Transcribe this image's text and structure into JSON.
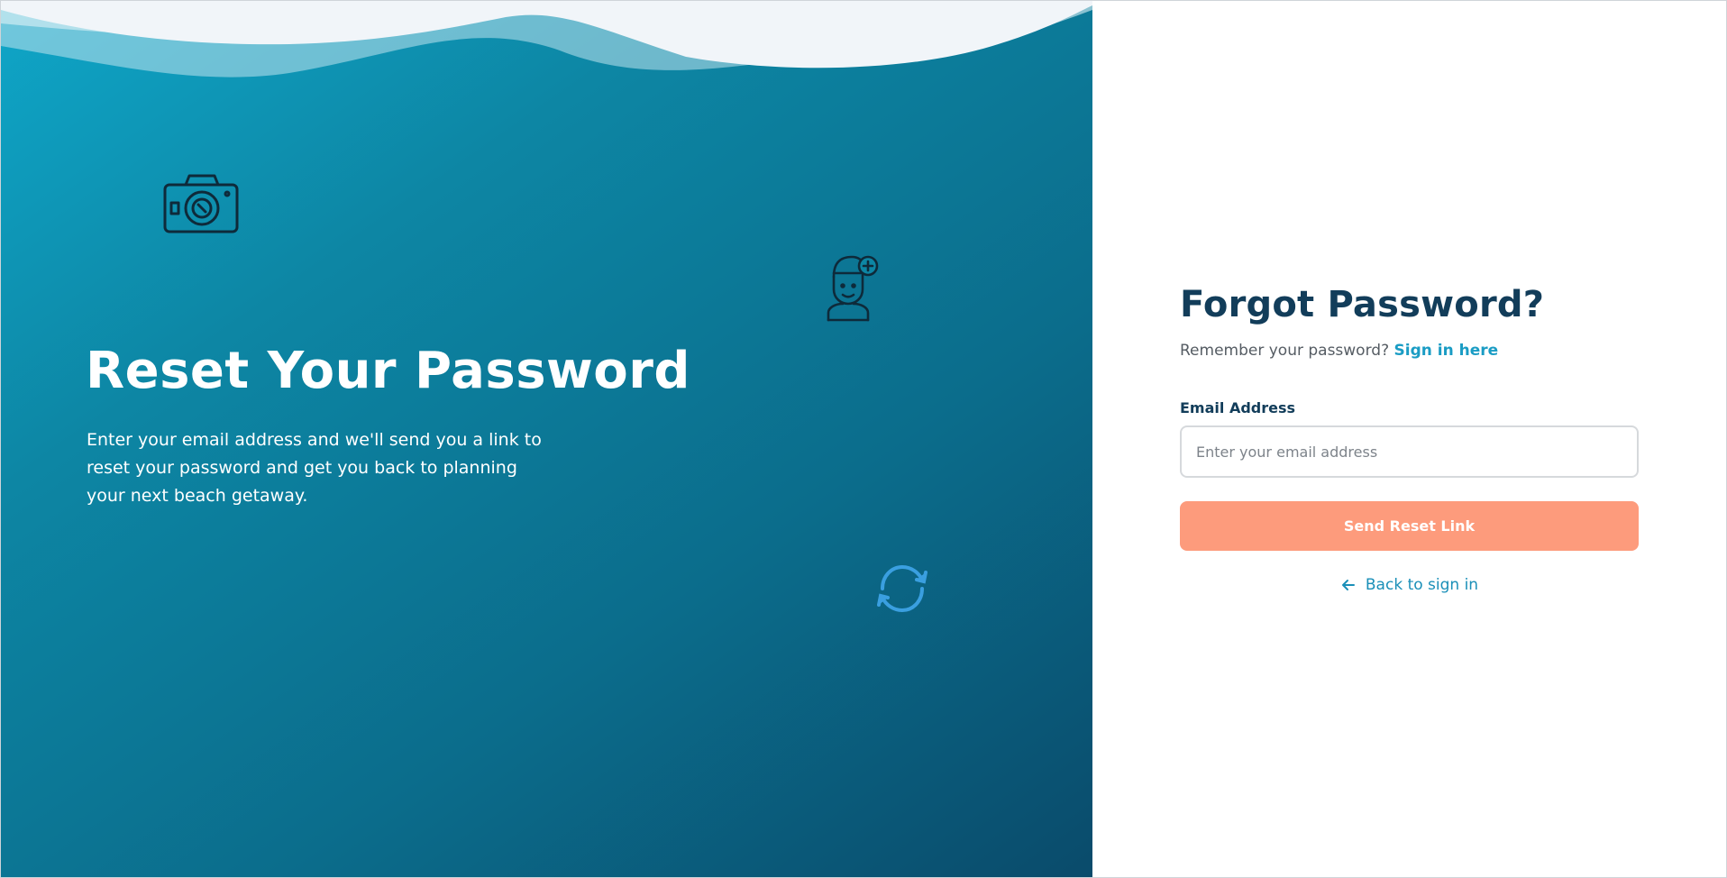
{
  "hero": {
    "title": "Reset Your Password",
    "description": "Enter your email address and we'll send you a link to reset your password and get you back to planning your next beach getaway.",
    "icons": [
      "camera-icon",
      "traveler-icon",
      "refresh-icon"
    ]
  },
  "form": {
    "title": "Forgot Password?",
    "remember_text": "Remember your password?",
    "sign_in_link": "Sign in here",
    "email_label": "Email Address",
    "email_value": "",
    "email_placeholder": "Enter your email address",
    "submit_label": "Send Reset Link",
    "back_label": "Back to sign in"
  },
  "colors": {
    "primary_dark": "#123d5a",
    "link": "#1a9cc4",
    "accent": "#fd9b7c",
    "hero_start": "#0fa6c8",
    "hero_end": "#0a4b6b"
  }
}
